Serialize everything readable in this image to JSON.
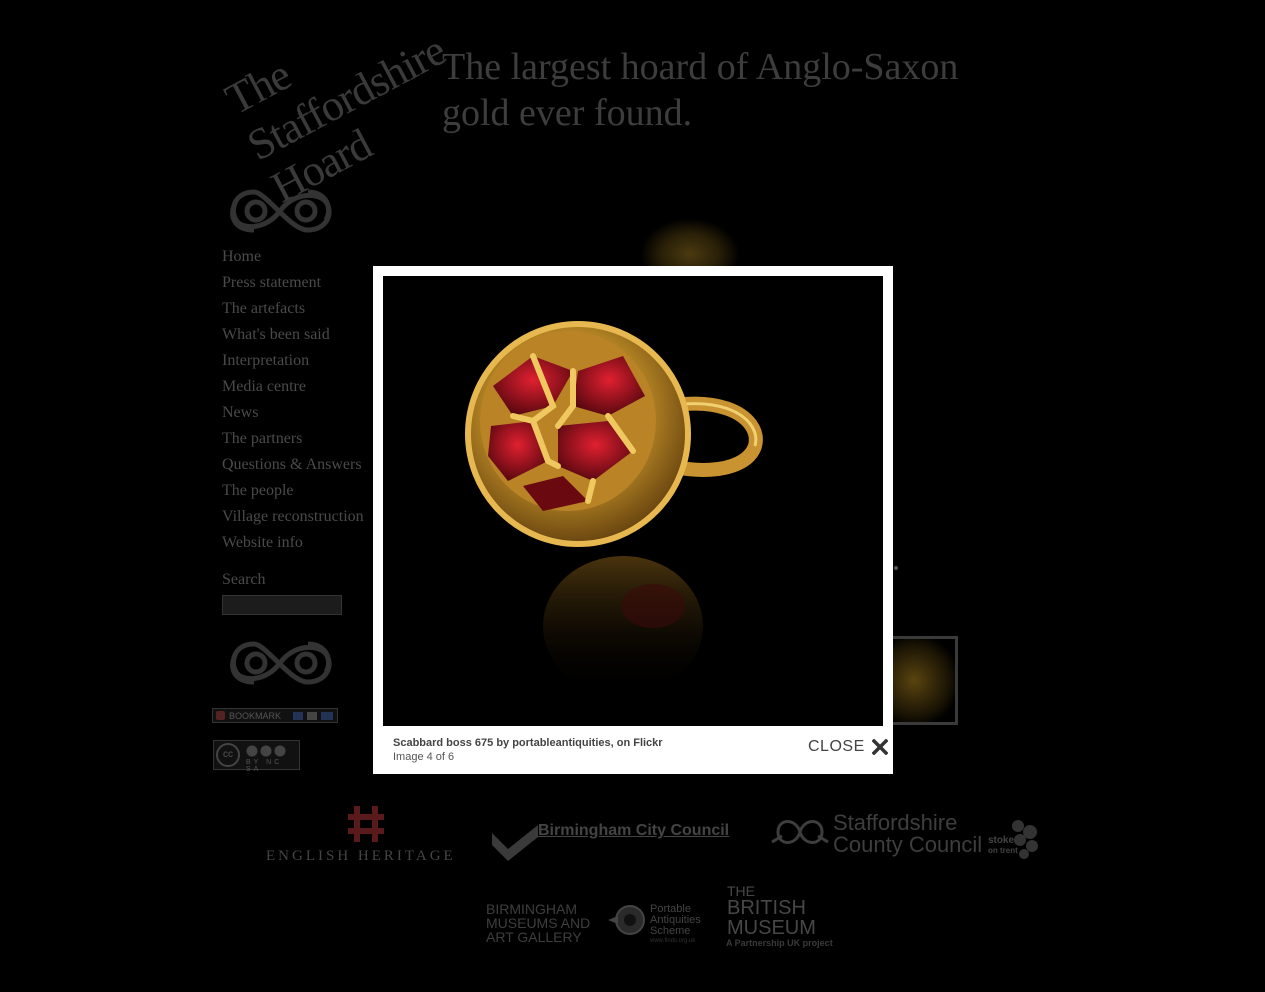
{
  "logo": {
    "line1": "The",
    "line2": "Staffordshire",
    "line3": "Hoard"
  },
  "tagline": {
    "line1": "The largest hoard of Anglo-Saxon",
    "line2": "gold ever found."
  },
  "nav": {
    "items": [
      "Home",
      "Press statement",
      "The artefacts",
      "What's been said",
      "Interpretation",
      "Media centre",
      "News",
      "The partners",
      "Questions & Answers",
      "The people",
      "Village reconstruction",
      "Website info"
    ]
  },
  "search": {
    "label": "Search",
    "value": ""
  },
  "bookmark": {
    "label": "BOOKMARK"
  },
  "license": {
    "cc_label": "cc",
    "terms": "BY NC SA"
  },
  "partners": {
    "english_heritage": "ENGLISH HERITAGE",
    "birmingham_cc": "Birmingham City Council",
    "staffordshire_cc_line1": "Staffordshire",
    "staffordshire_cc_line2": "County Council",
    "stoke_line1": "stoke",
    "stoke_line2": "on trent",
    "bmag_line1": "BIRMINGHAM",
    "bmag_line2": "MUSEUMS AND",
    "bmag_line3": "ART GALLERY",
    "pas_line1": "Portable",
    "pas_line2": "Antiquities",
    "pas_line3": "Scheme",
    "pas_url": "www.finds.org.uk",
    "bm_line1": "THE",
    "bm_line2": "BRITISH",
    "bm_line3": "MUSEUM",
    "bm_sub": "A Partnership UK project"
  },
  "lightbox": {
    "caption": "Scabbard boss 675 by portableantiquities, on Flickr",
    "counter": "Image 4 of 6",
    "close_label": "CLOSE",
    "image_icon": "scabbard-boss-photo"
  },
  "colors": {
    "background": "#000000",
    "nav_text": "#4a4a4a",
    "lightbox_frame": "#ffffff",
    "gold": "#c8952a",
    "garnet": "#b0101c"
  }
}
